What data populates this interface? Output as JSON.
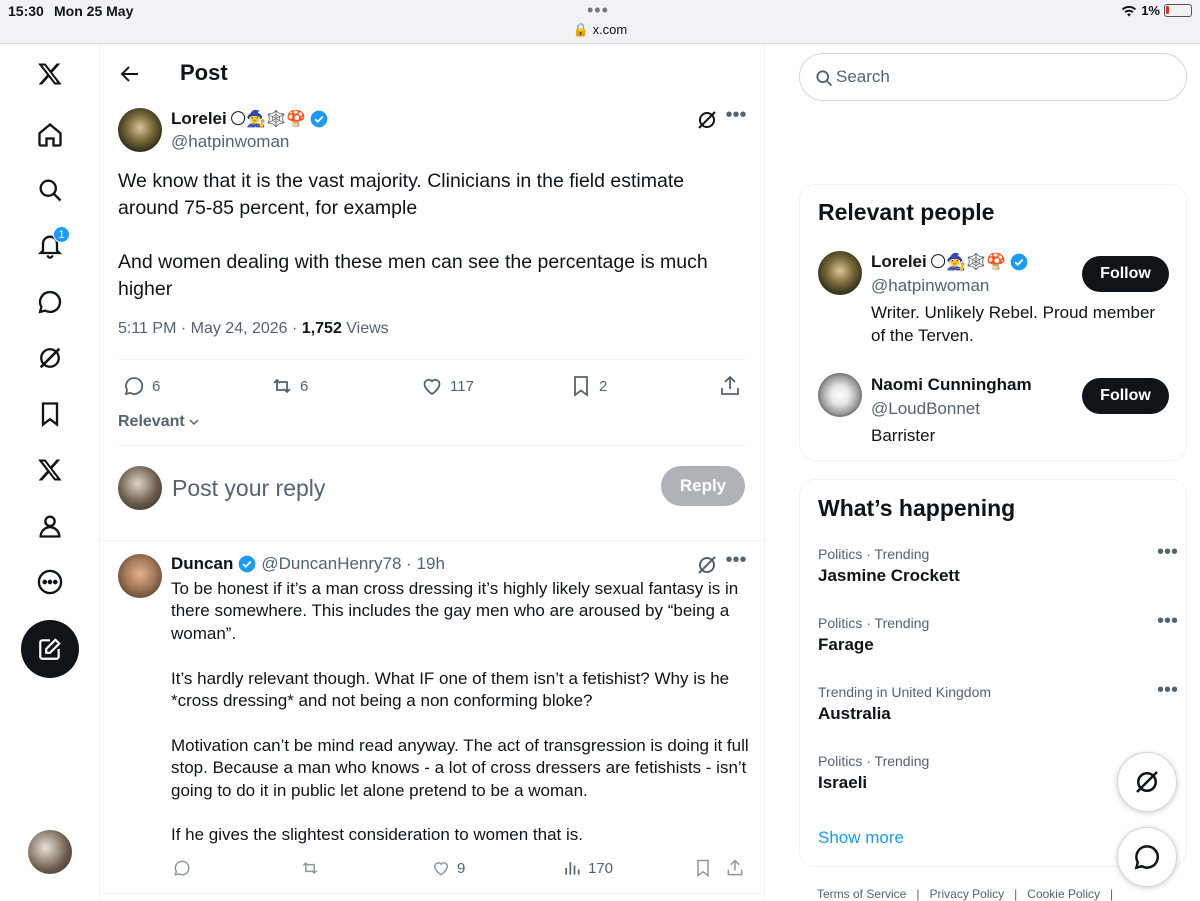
{
  "status_bar": {
    "time": "15:30",
    "date": "Mon 25 May",
    "url": "x.com",
    "battery": "1%"
  },
  "header": {
    "title": "Post"
  },
  "post": {
    "author_name": "Lorelei",
    "author_emojis": "🌕🧙‍♀️🕸️🍄",
    "author_handle": "@hatpinwoman",
    "text": "We know that it is the vast majority. Clinicians in the field estimate around 75-85 percent, for example\n\nAnd women dealing with these men can see the percentage is much higher",
    "time": "5:11 PM · May 24, 2026 · ",
    "views_count": "1,752",
    "views_label": " Views",
    "replies": "6",
    "reposts": "6",
    "likes": "117",
    "bookmarks": "2"
  },
  "sort_label": "Relevant",
  "reply_box": {
    "placeholder": "Post your reply",
    "button": "Reply"
  },
  "reply": {
    "author_name": "Duncan",
    "author_handle": "@DuncanHenry78 · 19h",
    "text": "To be honest if it’s a man cross dressing it’s highly likely sexual fantasy is in there somewhere. This includes the gay men who are aroused by “being a woman”.\n\nIt’s hardly relevant though. What IF one of them isn’t a fetishist? Why is he *cross dressing* and not being a non conforming bloke?\n\nMotivation can’t be mind read anyway. The act of transgression is doing it full stop. Because a man who knows - a lot of cross dressers are fetishists - isn’t going to do it in public let alone pretend to be a woman.\n\nIf he gives the slightest consideration to women that is.",
    "likes": "9",
    "views": "170"
  },
  "search": {
    "placeholder": "Search"
  },
  "relevant_people": {
    "title": "Relevant people",
    "people": [
      {
        "name": "Lorelei",
        "emojis": "🌕🧙‍♀️🕸️🍄",
        "handle": "@hatpinwoman",
        "bio": "Writer. Unlikely Rebel. Proud member of the Terven.",
        "button": "Follow"
      },
      {
        "name": "Naomi Cunningham",
        "emojis": "",
        "handle": "@LoudBonnet",
        "bio": "Barrister",
        "button": "Follow"
      }
    ]
  },
  "whats_happening": {
    "title": "What’s happening",
    "trends": [
      {
        "meta": "Politics · Trending",
        "name": "Jasmine Crockett"
      },
      {
        "meta": "Politics · Trending",
        "name": "Farage"
      },
      {
        "meta": "Trending in United Kingdom",
        "name": "Australia"
      },
      {
        "meta": "Politics · Trending",
        "name": "Israeli"
      }
    ],
    "show_more": "Show more"
  },
  "footer": {
    "links": [
      "Terms of Service",
      "|",
      "Privacy Policy",
      "|",
      "Cookie Policy",
      "|"
    ]
  },
  "nav": {
    "notification_count": "1"
  },
  "colors": {
    "accent": "#1d9bf0",
    "text": "#0f1419",
    "muted": "#536471",
    "verified": "#1d9bf0"
  }
}
